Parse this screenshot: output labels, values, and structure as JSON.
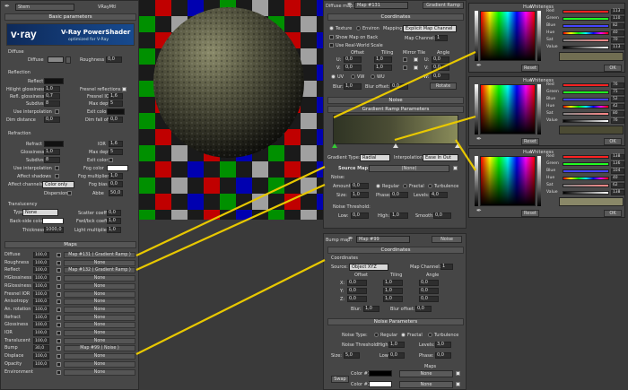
{
  "left_panel": {
    "material_name": "Stem",
    "material_type": "VRayMtl",
    "basic_parameters": "Basic parameters",
    "banner_logo": "v·ray",
    "banner_title": "V-Ray PowerShader",
    "banner_subtitle": "optimized for V-Ray",
    "diffuse_group": "Diffuse",
    "diffuse_label": "Diffuse",
    "roughness_label": "Roughness",
    "roughness_value": "0,0",
    "reflection_group": "Reflection",
    "reflect_label": "Reflect",
    "hilight_gloss_label": "Hilight glossiness",
    "hilight_gloss_value": "1,0",
    "refl_gloss_label": "Refl. glossiness",
    "refl_gloss_value": "0,7",
    "subdivs_label": "Subdivs",
    "subdivs_value": "8",
    "use_interp_label": "Use interpolation",
    "dim_distance_label": "Dim distance",
    "dim_distance_value": "0,0",
    "fresnel_label": "Fresnel reflections",
    "fresnel_ior_label": "Fresnel IOR",
    "fresnel_ior_value": "1,6",
    "max_depth_label": "Max depth",
    "max_depth_value": "5",
    "exit_color_label": "Exit color",
    "dim_falloff_label": "Dim fall off",
    "dim_falloff_value": "0,0",
    "refraction_group": "Refraction",
    "refract_label": "Refract",
    "glossiness_label": "Glossiness",
    "glossiness_value": "1,0",
    "r_subdivs_label": "Subdivs",
    "r_subdivs_value": "8",
    "r_use_interp_label": "Use interpolation",
    "affect_shadows_label": "Affect shadows",
    "affect_channels_label": "Affect channels",
    "affect_channels_value": "Color only",
    "dispersion_label": "Dispersion",
    "ior_label": "IOR",
    "ior_value": "1,6",
    "r_max_depth_label": "Max depth",
    "r_max_depth_value": "5",
    "r_exit_color_label": "Exit color",
    "fog_color_label": "Fog color",
    "fog_multiplier_label": "Fog multiplier",
    "fog_multiplier_value": "1,0",
    "fog_bias_label": "Fog bias",
    "fog_bias_value": "0,0",
    "abbe_label": "Abbe",
    "abbe_value": "50,0",
    "translucency_group": "Translucency",
    "type_label": "Type",
    "type_value": "None",
    "backside_label": "Back-side color",
    "thickness_label": "Thickness",
    "thickness_value": "1000,0",
    "scatter_label": "Scatter coeff",
    "scatter_value": "0,0",
    "fwd_bck_label": "Fwd/bck coeff",
    "fwd_bck_value": "1,0",
    "light_mult_label": "Light multiplier",
    "light_mult_value": "1,0",
    "maps_title": "Maps",
    "maps": [
      {
        "name": "Diffuse",
        "value": "100,0",
        "map": "Map #131  ( Gradient Ramp )"
      },
      {
        "name": "Roughness",
        "value": "100,0",
        "map": "None"
      },
      {
        "name": "Reflect",
        "value": "100,0",
        "map": "Map #132  ( Gradient Ramp )"
      },
      {
        "name": "HGlossiness",
        "value": "100,0",
        "map": "None"
      },
      {
        "name": "RGlossiness",
        "value": "100,0",
        "map": "None"
      },
      {
        "name": "Fresnel IOR",
        "value": "100,0",
        "map": "None"
      },
      {
        "name": "Anisotropy",
        "value": "100,0",
        "map": "None"
      },
      {
        "name": "An. rotation",
        "value": "100,0",
        "map": "None"
      },
      {
        "name": "Refract",
        "value": "100,0",
        "map": "None"
      },
      {
        "name": "Glossiness",
        "value": "100,0",
        "map": "None"
      },
      {
        "name": "IOR",
        "value": "100,0",
        "map": "None"
      },
      {
        "name": "Translucent",
        "value": "100,0",
        "map": "None"
      },
      {
        "name": "Bump",
        "value": "30,0",
        "map": "Map #99  ( Noise )"
      },
      {
        "name": "Displace",
        "value": "100,0",
        "map": "None"
      },
      {
        "name": "Opacity",
        "value": "100,0",
        "map": "None"
      },
      {
        "name": "Environment",
        "value": "",
        "map": "None"
      }
    ]
  },
  "diffuse_map": {
    "label": "Diffuse map:",
    "name": "Map #131",
    "type": "Gradient Ramp",
    "coordinates_title": "Coordinates",
    "texture_opt": "Texture",
    "environ_opt": "Environ",
    "mapping_label": "Mapping:",
    "mapping_value": "Explicit Map Channel",
    "show_map_back": "Show Map on Back",
    "map_channel_label": "Map Channel:",
    "map_channel_value": "1",
    "real_world": "Use Real-World Scale",
    "offset_hdr": "Offset",
    "tiling_hdr": "Tiling",
    "mirror_tile_hdr": "Mirror Tile",
    "angle_hdr": "Angle",
    "u_label": "U:",
    "v_label": "V:",
    "w_label": "W:",
    "u_offset": "0,0",
    "v_offset": "0,0",
    "u_tiling": "1,0",
    "v_tiling": "1,0",
    "u_angle": "0,0",
    "v_angle": "0,0",
    "w_angle": "0,0",
    "uv_opt": "UV",
    "vw_opt": "VW",
    "wu_opt": "WU",
    "blur_label": "Blur:",
    "blur_value": "1,0",
    "blur_offset_label": "Blur offset:",
    "blur_offset_value": "0,0",
    "rotate_button": "Rotate",
    "noise_title": "Noise",
    "gradient_params_title": "Gradient Ramp Parameters",
    "gradient_type_label": "Gradient Type:",
    "gradient_type_value": "Radial",
    "interp_label": "Interpolation:",
    "interp_value": "Ease In Out",
    "source_map_label": "Source Map:",
    "source_map_value": "(None)",
    "noise_group": "Noise:",
    "amount_label": "Amount:",
    "amount_value": "0,0",
    "regular_opt": "Regular",
    "fractal_opt": "Fractal",
    "turbulence_opt": "Turbulence",
    "size_label": "Size:",
    "size_value": "1,0",
    "phase_label": "Phase:",
    "phase_value": "0,0",
    "levels_label": "Levels:",
    "levels_value": "4,0",
    "noise_threshold_group": "Noise Threshold:",
    "low_label": "Low:",
    "low_value": "0,0",
    "high_label": "High:",
    "high_value": "1,0",
    "smooth_label": "Smooth:",
    "smooth_value": "0,0"
  },
  "bump_map": {
    "label": "Bump map:",
    "name": "Map #99",
    "type": "Noise",
    "coordinates_title": "Coordinates",
    "coordinates_group": "Coordinates",
    "source_label": "Source:",
    "source_value": "Object XYZ",
    "map_channel_label": "Map Channel:",
    "map_channel_value": "1",
    "offset_hdr": "Offset",
    "tiling_hdr": "Tiling",
    "angle_hdr": "Angle",
    "x_label": "X:",
    "y_label": "Y:",
    "z_label": "Z:",
    "x_offset": "0,0",
    "y_offset": "0,0",
    "z_offset": "0,0",
    "x_tiling": "1,0",
    "y_tiling": "1,0",
    "z_tiling": "1,0",
    "x_angle": "0,0",
    "y_angle": "0,0",
    "z_angle": "0,0",
    "blur_label": "Blur:",
    "blur_value": "1,0",
    "blur_offset_label": "Blur offset:",
    "blur_offset_value": "0,0",
    "noise_params_title": "Noise Parameters",
    "noise_type_label": "Noise Type:",
    "regular_opt": "Regular",
    "fractal_opt": "Fractal",
    "turbulence_opt": "Turbulence",
    "noise_threshold_label": "Noise Threshold:",
    "high_label": "High:",
    "high_value": "1,0",
    "levels_label": "Levels:",
    "levels_value": "3,0",
    "low_label": "Low:",
    "low_value": "0,0",
    "phase_label": "Phase:",
    "phase_value": "0,0",
    "size_label": "Size:",
    "size_value": "5,0",
    "maps_hdr": "Maps",
    "swap_button": "Swap",
    "color1_label": "Color #1",
    "color2_label": "Color #2",
    "color1_map": "None",
    "color2_map": "None"
  },
  "color_pickers": [
    {
      "hue": "Hue",
      "whiteness": "Whiteness",
      "red": "Red",
      "green": "Green",
      "blue": "Blue",
      "hue2": "Hue",
      "sat": "Sat",
      "value": "Value",
      "reset": "Reset",
      "ok": "OK",
      "red_v": "113",
      "green_v": "110",
      "blue_v": "82",
      "hue_v": "40",
      "sat_v": "70",
      "value_v": "113"
    },
    {
      "hue": "Hue",
      "whiteness": "Whiteness",
      "red": "Red",
      "green": "Green",
      "blue": "Blue",
      "hue2": "Hue",
      "sat": "Sat",
      "value": "Value",
      "reset": "Reset",
      "ok": "OK",
      "red_v": "76",
      "green_v": "75",
      "blue_v": "52",
      "hue_v": "42",
      "sat_v": "80",
      "value_v": "76"
    },
    {
      "hue": "Hue",
      "whiteness": "Whiteness",
      "red": "Red",
      "green": "Green",
      "blue": "Blue",
      "hue2": "Hue",
      "sat": "Sat",
      "value": "Value",
      "reset": "Reset",
      "ok": "OK",
      "red_v": "138",
      "green_v": "136",
      "blue_v": "104",
      "hue_v": "40",
      "sat_v": "62",
      "value_v": "138"
    }
  ],
  "colors": {
    "yellow_connector": "#e8c800",
    "ramp_dark": "#2f3424",
    "ramp_light": "#8a8c5a"
  }
}
